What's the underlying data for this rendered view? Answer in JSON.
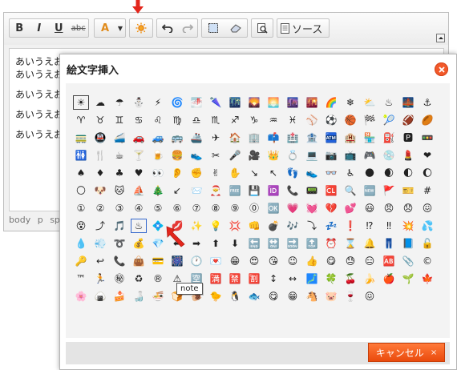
{
  "toolbar": {
    "bold": "B",
    "italic": "I",
    "underline": "U",
    "strike": "abc",
    "color": "A",
    "source_label": "ソース"
  },
  "editor": {
    "paragraphs": [
      {
        "lines": [
          "あいうえお",
          "あいうえお"
        ]
      },
      {
        "lines": [
          "あいうえお"
        ]
      },
      {
        "lines": [
          "あいうえお"
        ]
      },
      {
        "lines": [
          "あいうえお"
        ]
      }
    ],
    "statusbar": [
      "body",
      "p",
      "sp"
    ]
  },
  "dialog": {
    "title": "絵文字挿入",
    "tooltip": "note",
    "cancel_label": "キャンセル",
    "cancel_x": "×"
  },
  "emoji": [
    "☀",
    "☁",
    "☂",
    "⛄",
    "⚡",
    "🌀",
    "🌁",
    "🌂",
    "🌃",
    "🌄",
    "🌅",
    "🌆",
    "🌇",
    "🌈",
    "❄",
    "⛅",
    "♨",
    "🌉",
    "⚓",
    "♈",
    "♉",
    "♊",
    "♋",
    "♌",
    "♍",
    "♎",
    "♏",
    "♐",
    "♑",
    "♒",
    "♓",
    "⚾",
    "⚽",
    "🏀",
    "🏁",
    "🎾",
    "🏈",
    "🏉",
    "🚃",
    "🚇",
    "🚄",
    "🚗",
    "🚙",
    "🚌",
    "🚢",
    "✈",
    "🏠",
    "🏢",
    "📫",
    "🏥",
    "🏦",
    "🏧",
    "🏨",
    "🏪",
    "⛽",
    "🅿",
    "🚥",
    "🚻",
    "🍴",
    "☕",
    "🍸",
    "🍺",
    "🍔",
    "👟",
    "✂",
    "🎤",
    "🎥",
    "👑",
    "💍",
    "💻",
    "📷",
    "📺",
    "🎮",
    "💿",
    "💄",
    "❤",
    "♠",
    "♦",
    "♣",
    "♥",
    "👀",
    "👂",
    "✊",
    "✌",
    "✋",
    "↘",
    "↖",
    "👣",
    "👟",
    "👓",
    "♿",
    "🌑",
    "🌒",
    "🌓",
    "🌔",
    "🌕",
    "🐶",
    "🐱",
    "⛵",
    "🎄",
    "↙",
    "📨",
    "🎅",
    "🆓",
    "💾",
    "🆔",
    "📞",
    "📟",
    "🆑",
    "🔍",
    "🆕",
    "🚩",
    "🎫",
    "#",
    "①",
    "②",
    "③",
    "④",
    "⑤",
    "⑥",
    "⑦",
    "⑧",
    "⑨",
    "⓪",
    "🆗",
    "💗",
    "💓",
    "💔",
    "💕",
    "😃",
    "😠",
    "😞",
    "😖",
    "😵",
    "⤴",
    "🎵",
    "♨",
    "💠",
    "💋",
    "✨",
    "💡",
    "💢",
    "👊",
    "💣",
    "🎶",
    "⤵",
    "💤",
    "❗",
    "⁉",
    "‼",
    "💥",
    "💦",
    "💧",
    "💨",
    "➰",
    "💰",
    "💎",
    "⬅",
    "➡",
    "⬆",
    "⬇",
    "🔚",
    "🔛",
    "🔜",
    "🔝",
    "⏰",
    "⌛",
    "🔔",
    "👖",
    "📘",
    "🔓",
    "🔑",
    "↩",
    "📞",
    "👜",
    "💳",
    "🎆",
    "🕐",
    "💌",
    "😁",
    "😍",
    "😘",
    "😉",
    "👍",
    "😋",
    "😓",
    "😑",
    "🆎",
    "📎",
    "©",
    "™",
    "🏃",
    "㊙",
    "♻",
    "®",
    "⚠",
    "🈳",
    "🈵",
    "🈲",
    "🈹",
    "↕",
    "↔",
    "🗾",
    "🍀",
    "🍒",
    "🍌",
    "🍎",
    "🌱",
    "🍁",
    "🌸",
    "🍙",
    "🍰",
    "🍶",
    "🍜",
    "🍞",
    "🐌",
    "🐤",
    "🐧",
    "🐟",
    "😋",
    "😁",
    "🐴",
    "🐷",
    "🍷",
    "😖",
    "",
    "",
    ""
  ]
}
